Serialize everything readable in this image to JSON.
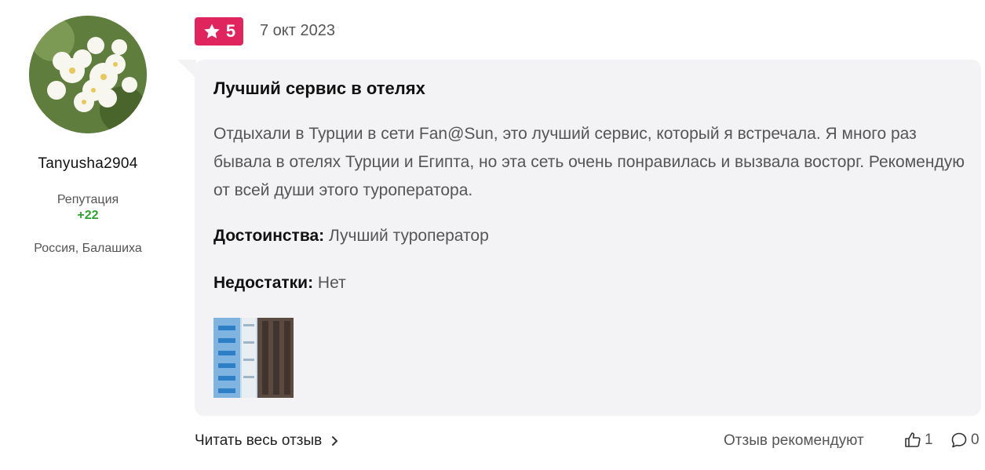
{
  "author": {
    "username": "Tanyusha2904",
    "reputation_label": "Репутация",
    "reputation_value": "+22",
    "location": "Россия, Балашиха",
    "avatar_icon": "jasmine-flowers-photo"
  },
  "review": {
    "rating": "5",
    "date": "7 окт 2023",
    "title": "Лучший сервис в отелях",
    "text": "Отдыхали в Турции в сети Fan@Sun, это лучший сервис, который я встречала. Я много раз бывала в отелях Турции и Египта, но эта сеть очень понравилась и вызвала восторг. Рекомендую от всей души этого туроператора.",
    "pros_label": "Достоинства:",
    "pros_value": "Лучший туроператор",
    "cons_label": "Недостатки:",
    "cons_value": "Нет",
    "photo_icon": "hotel-photo-thumbnail"
  },
  "footer": {
    "read_more": "Читать весь отзыв",
    "recommend_label": "Отзыв рекомендуют",
    "likes_count": "1",
    "comments_count": "0"
  },
  "colors": {
    "badge": "#e0245e",
    "reputation": "#2fa32f",
    "bubble": "#f3f3f5"
  }
}
